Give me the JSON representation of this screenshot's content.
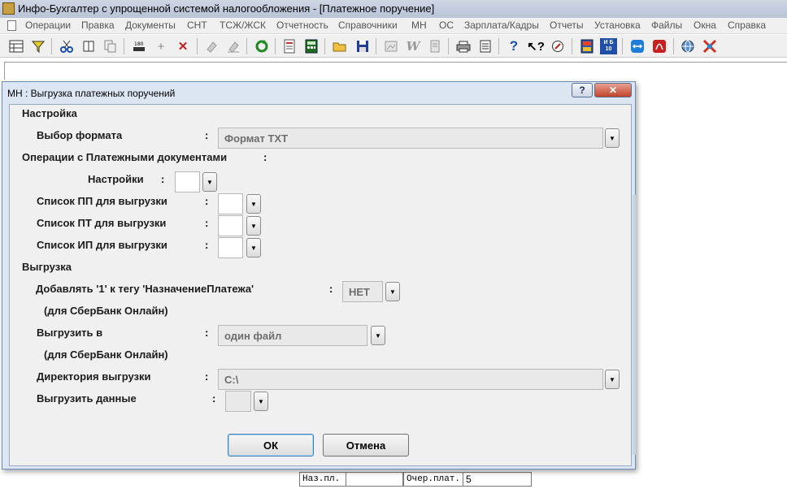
{
  "window": {
    "title": "Инфо-Бухгалтер с упрощенной системой налогообложения - [Платежное поручение]"
  },
  "menu": {
    "items": [
      "Операции",
      "Правка",
      "Документы",
      "СНТ",
      "ТСЖ/ЖСК",
      "Отчетность",
      "Справочники",
      "МН",
      "ОС",
      "Зарплата/Кадры",
      "Отчеты",
      "Установка",
      "Файлы",
      "Окна",
      "Справка"
    ]
  },
  "toolbar": {
    "icons": [
      "table-icon",
      "filter-icon",
      "cut-icon",
      "split-icon",
      "copy-icon",
      "barcode-icon",
      "plus-icon",
      "delete-icon",
      "eraser-icon",
      "eraser2-icon",
      "refresh-icon",
      "report-icon",
      "calculator-icon",
      "open-folder-icon",
      "save-icon",
      "img-icon",
      "word-icon",
      "doc-icon",
      "print-icon",
      "preview-icon",
      "help-icon",
      "whatis-icon",
      "compass-icon",
      "book-icon",
      "ib10-icon",
      "teamviewer-icon",
      "pdf-icon",
      "web-icon",
      "network-icon"
    ],
    "ib10_label": "И Б 10"
  },
  "background": {
    "cells": [
      "Наз.пл.",
      "Очер.плат.",
      "5"
    ]
  },
  "dialog": {
    "title": "МН : Выгрузка платежных поручений",
    "help_label": "?",
    "close_label": "✕",
    "section_settings": "Настройка",
    "format_label": "Выбор формата",
    "format_value": "Формат TXT",
    "operations_label": "Операции с Платежными документами",
    "operations_colon": ":",
    "settings_label": "Настройки",
    "pp_label": "Список ПП для выгрузки",
    "pt_label": "Список ПТ для выгрузки",
    "ip_label": "Список ИП для выгрузки",
    "section_export": "Выгрузка",
    "add_one_label": "Добавлять '1' к тегу 'НазначениеПлатежа'",
    "add_one_value": "НЕТ",
    "sber_note_1": "(для СберБанк Онлайн)",
    "export_to_label": "Выгрузить в",
    "export_to_value": "один файл",
    "sber_note_2": "(для СберБанк Онлайн)",
    "directory_label": "Директория выгрузки",
    "directory_value": "C:\\",
    "export_data_label": "Выгрузить данные",
    "colon": ":",
    "ok_label": "ОК",
    "cancel_label": "Отмена",
    "dropdown_glyph": "▼"
  }
}
